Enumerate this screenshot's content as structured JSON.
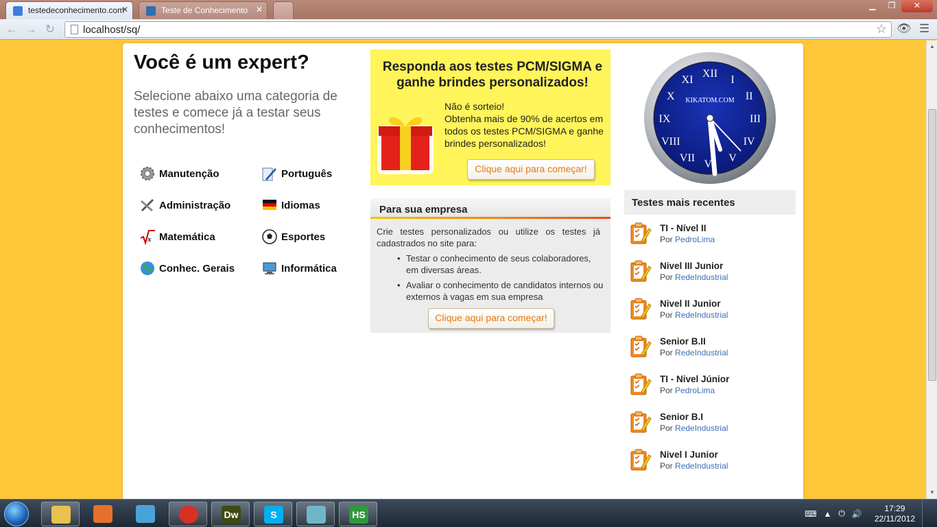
{
  "browser": {
    "tabs": [
      {
        "label": "testedeconhecimento.com",
        "favicon_color": "#3b7ddd"
      },
      {
        "label": "Teste de Conhecimento",
        "favicon_color": "#2e6fb0"
      }
    ],
    "url": "localhost/sq/"
  },
  "hero": {
    "title": "Você é um expert?",
    "subtitle": "Selecione abaixo uma categoria de testes e comece já a testar seus conhecimentos!"
  },
  "categories": [
    {
      "label": "Manutenção",
      "icon": "gear-icon"
    },
    {
      "label": "Português",
      "icon": "pen-icon"
    },
    {
      "label": "Administração",
      "icon": "tools-icon"
    },
    {
      "label": "Idiomas",
      "icon": "flag-icon"
    },
    {
      "label": "Matemática",
      "icon": "square-root-icon"
    },
    {
      "label": "Esportes",
      "icon": "soccer-ball-icon"
    },
    {
      "label": "Conhec. Gerais",
      "icon": "globe-icon"
    },
    {
      "label": "Informática",
      "icon": "computer-icon"
    }
  ],
  "promo": {
    "title": "Responda aos testes PCM/SIGMA e ganhe brindes personalizados!",
    "text_line1": "Não é sorteio!",
    "text_line2": "Obtenha mais de 90% de acertos em todos os testes PCM/SIGMA e ganhe brindes personalizados!",
    "button": "Clique aqui para começar!"
  },
  "business": {
    "title": "Para sua empresa",
    "intro": "Crie testes personalizados ou utilize os testes já cadastrados no site para:",
    "items": [
      "Testar o conhecimento de seus colaboradores, em diversas áreas.",
      "Avaliar o conhecimento de candidatos internos ou externos à vagas em sua empresa"
    ],
    "button": "Clique aqui para começar!"
  },
  "clock_widget": {
    "brand": "KIKATOM.COM",
    "numerals": [
      "XII",
      "I",
      "II",
      "III",
      "IV",
      "V",
      "VI",
      "VII",
      "VIII",
      "IX",
      "X",
      "XI"
    ],
    "face_color": "#0d1f8a"
  },
  "recent": {
    "title": "Testes mais recentes",
    "by_label": "Por",
    "items": [
      {
        "title": "TI - Nível II",
        "author": "PedroLima"
      },
      {
        "title": "Nivel III Junior",
        "author": "RedeIndustrial"
      },
      {
        "title": "Nivel II Junior",
        "author": "RedeIndustrial"
      },
      {
        "title": "Senior B.II",
        "author": "RedeIndustrial"
      },
      {
        "title": "TI - Nivel Júnior",
        "author": "PedroLima"
      },
      {
        "title": "Senior B.I",
        "author": "RedeIndustrial"
      },
      {
        "title": "Nivel I Junior",
        "author": "RedeIndustrial"
      }
    ]
  },
  "taskbar": {
    "apps": [
      {
        "name": "explorer",
        "color": "#e8c14e"
      },
      {
        "name": "media-player",
        "color": "#e6702a"
      },
      {
        "name": "messenger",
        "color": "#4aa3d8"
      },
      {
        "name": "chrome",
        "color": "#d93025"
      },
      {
        "name": "dreamweaver",
        "label": "Dw",
        "color": "#3e4a12"
      },
      {
        "name": "skype",
        "label": "S",
        "color": "#00aff0"
      },
      {
        "name": "notes",
        "color": "#6fb7c8"
      },
      {
        "name": "hotspot",
        "label": "HS",
        "color": "#2e9a3c"
      }
    ],
    "time": "17:29",
    "date": "22/11/2012"
  },
  "colors": {
    "page_background": "#ffc83a",
    "promo_background": "#fff45a",
    "link": "#3d6fb4",
    "button_text": "#e37a12"
  }
}
